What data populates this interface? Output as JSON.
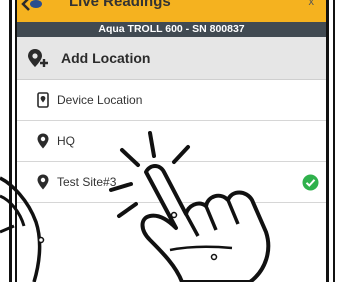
{
  "header": {
    "title": "Live Readings",
    "close": "x"
  },
  "device_bar": {
    "label": "Aqua TROLL 600 - SN 800837"
  },
  "section": {
    "title": "Add Location"
  },
  "locations": [
    {
      "label": "Device Location",
      "icon": "device-location-icon"
    },
    {
      "label": "HQ",
      "icon": "map-pin-icon"
    },
    {
      "label": "Test Site#3",
      "icon": "map-pin-icon",
      "selected": true
    }
  ],
  "colors": {
    "top_bar": "#f5b21f",
    "device_bar": "#414a52",
    "header_row": "#e6e6e6",
    "check": "#2fb14c"
  },
  "overlay": {
    "icon": "tap-gesture-icon"
  }
}
